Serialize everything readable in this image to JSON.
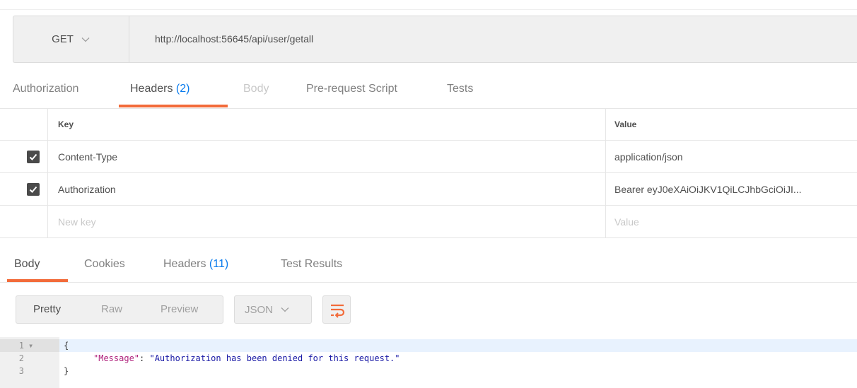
{
  "request": {
    "method": "GET",
    "url": "http://localhost:56645/api/user/getall"
  },
  "request_tabs": [
    {
      "label": "Authorization",
      "count": "",
      "state": "normal"
    },
    {
      "label": "Headers ",
      "count": "(2)",
      "state": "active"
    },
    {
      "label": "Body",
      "count": "",
      "state": "disabled"
    },
    {
      "label": "Pre-request Script",
      "count": "",
      "state": "normal"
    },
    {
      "label": "Tests",
      "count": "",
      "state": "normal"
    }
  ],
  "headers_table": {
    "columns": [
      "Key",
      "Value"
    ],
    "rows": [
      {
        "key": "Content-Type",
        "value": "application/json",
        "checked": true
      },
      {
        "key": "Authorization",
        "value": "Bearer eyJ0eXAiOiJKV1QiLCJhbGciOiJI...",
        "checked": true
      }
    ],
    "new_key_placeholder": "New key",
    "new_value_placeholder": "Value"
  },
  "response_tabs": [
    {
      "label": "Body",
      "count": "",
      "state": "active"
    },
    {
      "label": "Cookies",
      "count": "",
      "state": "normal"
    },
    {
      "label": "Headers ",
      "count": "(11)",
      "state": "normal"
    },
    {
      "label": "Test Results",
      "count": "",
      "state": "normal"
    }
  ],
  "toolbar": {
    "views": [
      "Pretty",
      "Raw",
      "Preview"
    ],
    "active_view": "Pretty",
    "format": "JSON",
    "wrap_icon": "wrap-lines-icon"
  },
  "response_body": {
    "lines": [
      {
        "num": "1",
        "fold": "▾",
        "text": "{"
      },
      {
        "num": "2",
        "fold": "",
        "key": "\"Message\"",
        "sep": ": ",
        "value": "\"Authorization has been denied for this request.\""
      },
      {
        "num": "3",
        "fold": "",
        "text": "}"
      }
    ]
  },
  "colors": {
    "accent": "#f26b3a",
    "count": "#097bed",
    "checkbox": "#4a4a4a"
  }
}
